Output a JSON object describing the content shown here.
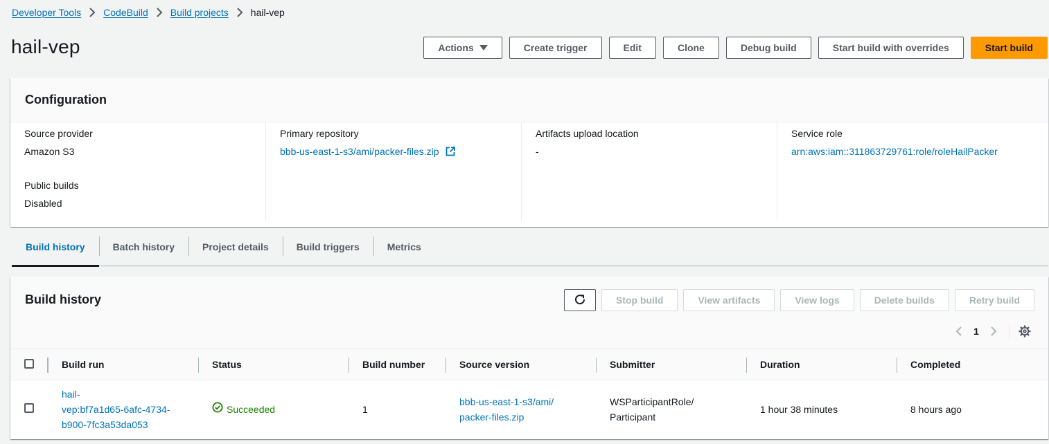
{
  "breadcrumb": {
    "items": [
      "Developer Tools",
      "CodeBuild",
      "Build projects"
    ],
    "current": "hail-vep"
  },
  "header": {
    "title": "hail-vep",
    "buttons": {
      "actions": "Actions",
      "create_trigger": "Create trigger",
      "edit": "Edit",
      "clone": "Clone",
      "debug_build": "Debug build",
      "start_overrides": "Start build with overrides",
      "start_build": "Start build"
    }
  },
  "configuration": {
    "title": "Configuration",
    "source_provider_label": "Source provider",
    "source_provider_value": "Amazon S3",
    "public_builds_label": "Public builds",
    "public_builds_value": "Disabled",
    "primary_repo_label": "Primary repository",
    "primary_repo_value": "bbb-us-east-1-s3/ami/packer-files.zip",
    "artifacts_label": "Artifacts upload location",
    "artifacts_value": "-",
    "service_role_label": "Service role",
    "service_role_value": "arn:aws:iam::311863729761:role/roleHailPacker"
  },
  "tabs": [
    "Build history",
    "Batch history",
    "Project details",
    "Build triggers",
    "Metrics"
  ],
  "build_history": {
    "title": "Build history",
    "buttons": {
      "stop": "Stop build",
      "view_artifacts": "View artifacts",
      "view_logs": "View logs",
      "delete": "Delete builds",
      "retry": "Retry build"
    },
    "page": "1",
    "columns": {
      "build_run": "Build run",
      "status": "Status",
      "build_number": "Build number",
      "source_version": "Source version",
      "submitter": "Submitter",
      "duration": "Duration",
      "completed": "Completed"
    },
    "rows": [
      {
        "build_run_line1": "hail-",
        "build_run_line2": "vep:bf7a1d65-6afc-4734-",
        "build_run_line3": "b900-7fc3a53da053",
        "status": "Succeeded",
        "build_number": "1",
        "source_version_line1": "bbb-us-east-1-s3/ami/",
        "source_version_line2": "packer-files.zip",
        "submitter_line1": "WSParticipantRole/",
        "submitter_line2": "Participant",
        "duration": "1 hour 38 minutes",
        "completed": "8 hours ago"
      }
    ]
  },
  "colors": {
    "link": "#0073bb",
    "primary": "#ff9900",
    "success": "#1d8102",
    "background": "#f2f3f3"
  }
}
